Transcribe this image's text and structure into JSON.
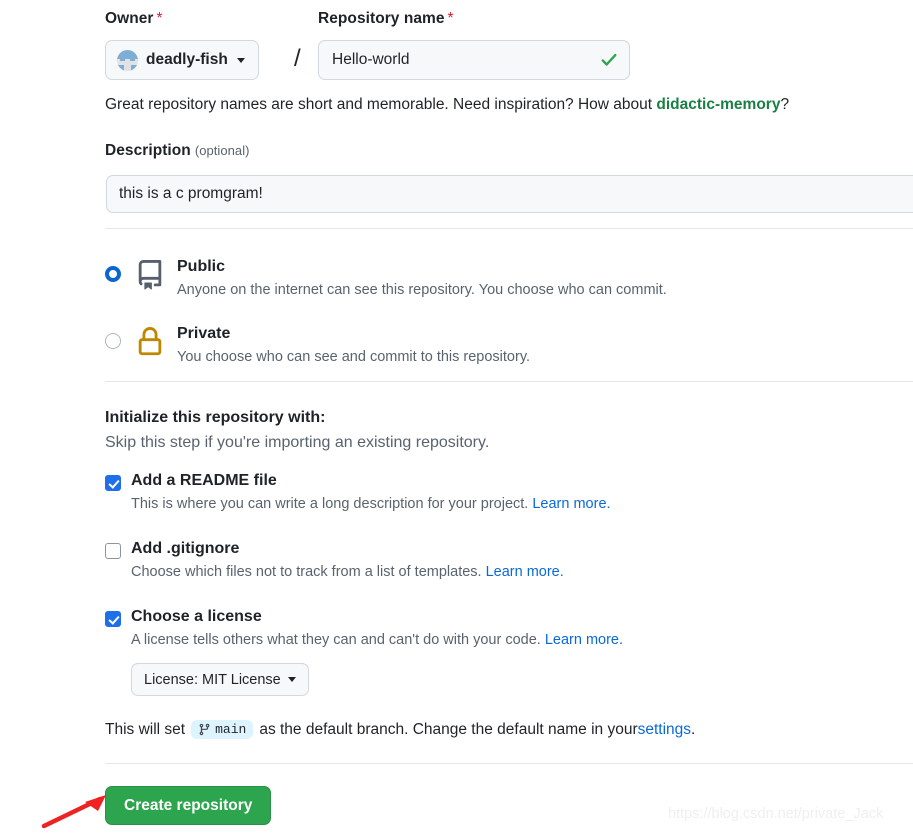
{
  "owner": {
    "label": "Owner",
    "required_mark": "*",
    "selected": "deadly-fish"
  },
  "separator": "/",
  "repository_name": {
    "label": "Repository name",
    "required_mark": "*",
    "value": "Hello-world",
    "placeholder": "",
    "valid": true
  },
  "hint": {
    "before": "Great repository names are short and memorable. Need inspiration? How about ",
    "suggestion": "didactic-memory",
    "after": "?"
  },
  "description": {
    "label": "Description",
    "optional_note": "(optional)",
    "value": "this is a c promgram!",
    "placeholder": ""
  },
  "visibility": {
    "options": [
      {
        "id": "public",
        "title": "Public",
        "subtitle": "Anyone on the internet can see this repository. You choose who can commit.",
        "selected": true,
        "icon": "repo-icon",
        "icon_color": "#57606a"
      },
      {
        "id": "private",
        "title": "Private",
        "subtitle": "You choose who can see and commit to this repository.",
        "selected": false,
        "icon": "lock-icon",
        "icon_color": "#bf8700"
      }
    ]
  },
  "initialize": {
    "title": "Initialize this repository with:",
    "subtitle": "Skip this step if you're importing an existing repository.",
    "options": [
      {
        "id": "readme",
        "title": "Add a README file",
        "subtitle": "This is where you can write a long description for your project. ",
        "learn_more": "Learn more.",
        "checked": true
      },
      {
        "id": "gitignore",
        "title": "Add .gitignore",
        "subtitle": "Choose which files not to track from a list of templates. ",
        "learn_more": "Learn more.",
        "checked": false
      },
      {
        "id": "license",
        "title": "Choose a license",
        "subtitle": "A license tells others what they can and can't do with your code. ",
        "learn_more": "Learn more.",
        "checked": true
      }
    ],
    "license_dropdown": {
      "label": "License: MIT License"
    }
  },
  "default_branch": {
    "before": "This will set",
    "branch": "main",
    "middle": "as the default branch. Change the default name in your ",
    "settings_link": "settings",
    "after": "."
  },
  "create_button": {
    "label": "Create repository"
  },
  "annotations": {
    "arrow": "red-arrow",
    "watermark": "https://blog.csdn.net/private_Jack"
  },
  "colors": {
    "accent_blue": "#0969da",
    "link_green": "#1a7f45",
    "button_green": "#2da44e",
    "lock_gold": "#bf8700",
    "checkbox_blue": "#1f6feb",
    "valid_check_green": "#2da44e",
    "arrow_red": "#ee2222"
  }
}
